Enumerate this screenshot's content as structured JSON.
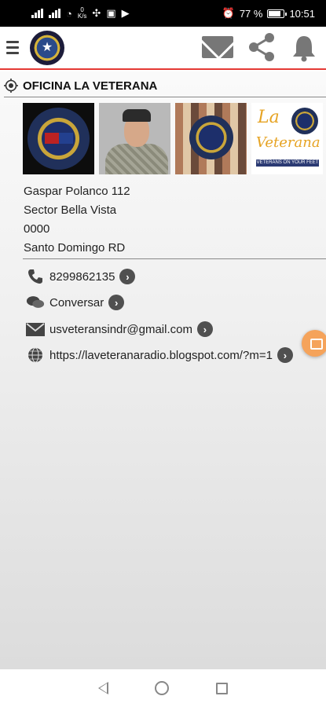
{
  "status_bar": {
    "battery_percent": "77 %",
    "time": "10:51",
    "data_rate": "0\nK/s"
  },
  "app_bar": {
    "icons": [
      "menu-icon",
      "app-logo",
      "mail-icon",
      "share-icon",
      "bell-icon"
    ]
  },
  "listing": {
    "title": "OFICINA LA VETERANA",
    "address": {
      "line1": "Gaspar Polanco 112",
      "line2": "Sector Bella Vista",
      "line3": "0000",
      "line4": "Santo Domingo RD"
    },
    "contacts": {
      "phone": "8299862135",
      "chat": "Conversar",
      "email": "usveteransindr@gmail.com",
      "website": "https://laveteranaradio.blogspot.com/?m=1"
    },
    "gallery_logo_text": {
      "brand": "La",
      "brand2": "Veterana",
      "tagline": "VETERANS ON YOUR FEET"
    }
  },
  "colors": {
    "accent": "#e53935",
    "icon_gray": "#505050",
    "fab": "#f5a35b"
  }
}
